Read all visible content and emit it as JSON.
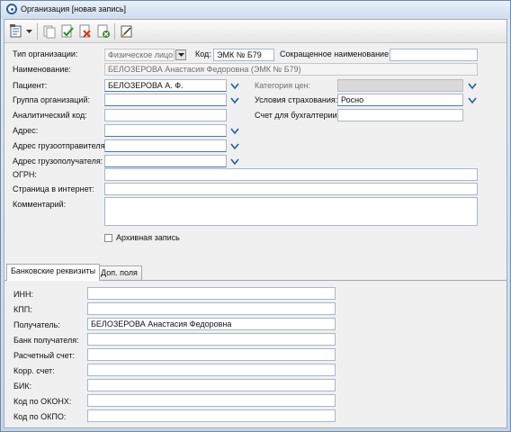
{
  "window": {
    "title": "Организация [новая запись]"
  },
  "toolbar": {
    "buttons": [
      {
        "name": "add-record-icon"
      },
      {
        "name": "dropdown-arrow-icon"
      },
      {
        "name": "copy-icon"
      },
      {
        "name": "save-check-icon"
      },
      {
        "name": "cancel-icon"
      },
      {
        "name": "close-record-icon"
      },
      {
        "name": "edit-icon"
      }
    ]
  },
  "form": {
    "org_type_label": "Тип организации:",
    "org_type_value": "Физическое лицо",
    "code_label": "Код:",
    "code_value": "ЭМК № Б79",
    "short_name_label": "Сокращенное наименование:",
    "short_name_value": "",
    "name_label": "Наименование:",
    "name_value": "БЕЛОЗЕРОВА Анастасия Федоровна (ЭМК № Б79)",
    "patient_label": "Пациент:",
    "patient_value": "БЕЛОЗЕРОВА А. Ф.",
    "price_category_label": "Категория цен:",
    "org_group_label": "Группа организаций:",
    "insurance_label": "Условия страхования:",
    "insurance_value": "Росно",
    "analytic_code_label": "Аналитический код:",
    "accounting_label": "Счет для бухгалтерии:",
    "address_label": "Адрес:",
    "shipper_address_label": "Адрес грузоотправителя:",
    "consignee_address_label": "Адрес грузополучателя:",
    "ogrn_label": "ОГРН:",
    "website_label": "Страница в интернет:",
    "comments_label": "Комментарий:",
    "archive_label": "Архивная запись"
  },
  "tabs": [
    {
      "label": "Банковские реквизиты",
      "active": true
    },
    {
      "label": "Доп. поля",
      "active": false
    }
  ],
  "bank": {
    "inn_label": "ИНН:",
    "kpp_label": "КПП:",
    "recipient_label": "Получатель:",
    "recipient_value": "БЕЛОЗЕРОВА Анастасия Федоровна",
    "bank_label": "Банк получателя:",
    "account_label": "Расчетный счет:",
    "corr_account_label": "Корр. счет:",
    "bik_label": "БИК:",
    "okonh_label": "Код по ОКОНХ:",
    "okpo_label": "Код по ОКПО:"
  },
  "colors": {
    "chevron": "#1f5fa8",
    "window_frame": "#6f8aa8"
  }
}
